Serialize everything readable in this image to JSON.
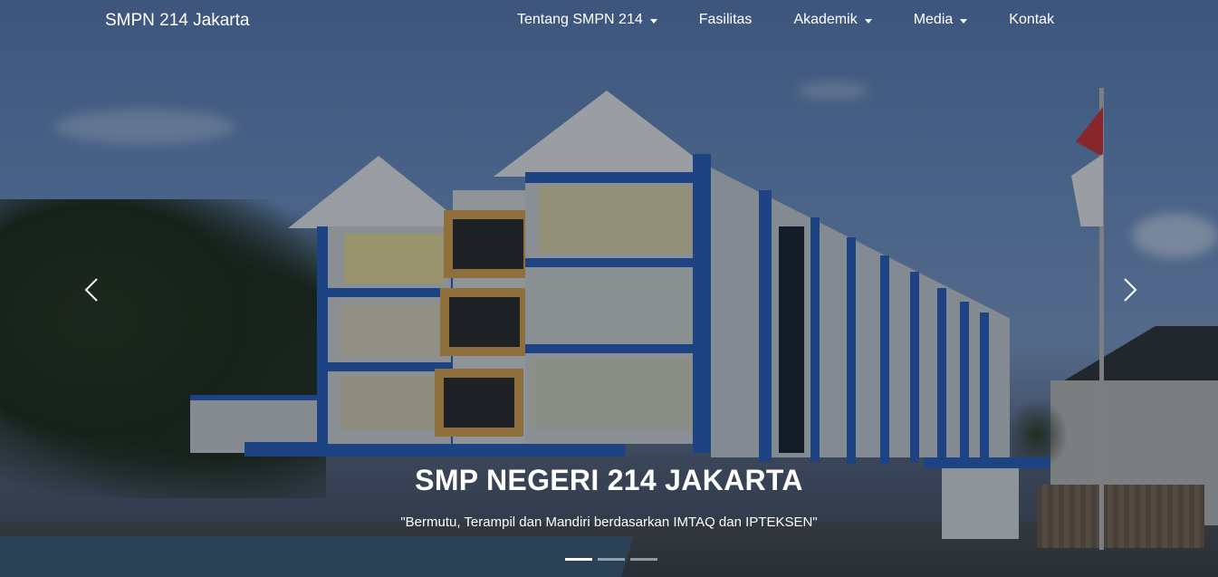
{
  "brand": "SMPN 214 Jakarta",
  "nav": {
    "items": [
      {
        "label": "Tentang SMPN 214",
        "dropdown": true
      },
      {
        "label": "Fasilitas",
        "dropdown": false
      },
      {
        "label": "Akademik",
        "dropdown": true
      },
      {
        "label": "Media",
        "dropdown": true
      },
      {
        "label": "Kontak",
        "dropdown": false
      }
    ]
  },
  "carousel": {
    "title": "SMP NEGERI 214 JAKARTA",
    "subtitle": "\"Bermutu, Terampil dan Mandiri berdasarkan IMTAQ dan IPTEKSEN\"",
    "slide_count": 3,
    "active_index": 0,
    "prev_icon": "chevron-left-icon",
    "next_icon": "chevron-right-icon"
  },
  "colors": {
    "accent_blue": "#2a5fb8",
    "text": "#ffffff"
  }
}
